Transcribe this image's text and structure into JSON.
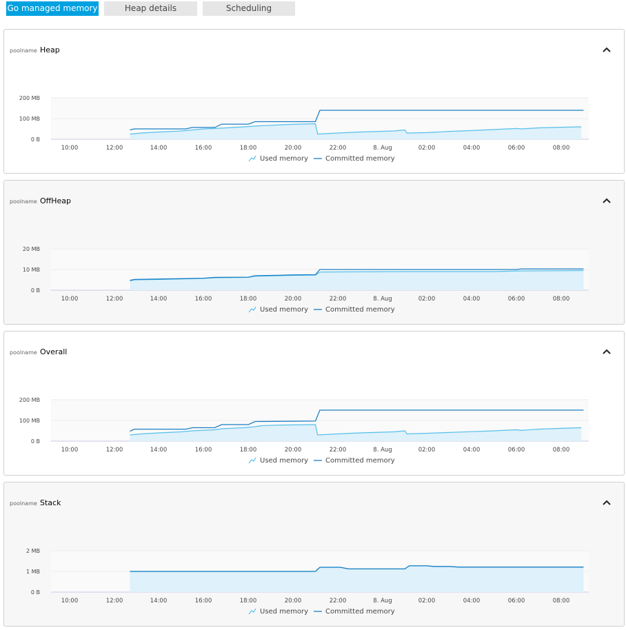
{
  "tabs": [
    {
      "label": "Go managed memory",
      "active": true
    },
    {
      "label": "Heap details",
      "active": false
    },
    {
      "label": "Scheduling",
      "active": false
    }
  ],
  "colors": {
    "accent": "#00a1e0",
    "committed_line": "#1a7fc4",
    "used_line": "#55bfea",
    "used_fill": "#dff1fa"
  },
  "legend": {
    "used": "Used memory",
    "committed": "Committed memory"
  },
  "panels": [
    {
      "pool_key": "poolname",
      "pool_name": "Heap",
      "chart_data": {
        "type": "area",
        "title": "",
        "xlabel": "",
        "ylabel": "",
        "x_ticks": [
          "10:00",
          "12:00",
          "14:00",
          "16:00",
          "18:00",
          "20:00",
          "22:00",
          "8. Aug",
          "02:00",
          "04:00",
          "06:00",
          "08:00"
        ],
        "y_ticks": [
          "0 B",
          "100 MB",
          "200 MB"
        ],
        "ylim_mb": [
          0,
          200
        ],
        "x_unit": "hours since 09:00 on 7 Aug",
        "series": [
          {
            "name": "Used memory",
            "type": "area",
            "points": [
              [
                3.7,
                25
              ],
              [
                4.2,
                30
              ],
              [
                5.0,
                35
              ],
              [
                6.0,
                40
              ],
              [
                6.5,
                45
              ],
              [
                7.0,
                50
              ],
              [
                7.5,
                52
              ],
              [
                8.0,
                55
              ],
              [
                8.8,
                60
              ],
              [
                9.1,
                62
              ],
              [
                9.5,
                65
              ],
              [
                10.5,
                70
              ],
              [
                11.0,
                72
              ],
              [
                12.0,
                75
              ],
              [
                12.1,
                25
              ],
              [
                13.0,
                30
              ],
              [
                14.0,
                35
              ],
              [
                15.5,
                40
              ],
              [
                16.0,
                45
              ],
              [
                16.1,
                30
              ],
              [
                17.0,
                32
              ],
              [
                18.0,
                38
              ],
              [
                19.0,
                42
              ],
              [
                20.0,
                47
              ],
              [
                21.0,
                52
              ],
              [
                21.2,
                50
              ],
              [
                22.0,
                55
              ],
              [
                23.0,
                58
              ],
              [
                23.9,
                60
              ]
            ]
          },
          {
            "name": "Committed memory",
            "type": "line",
            "points": [
              [
                3.7,
                45
              ],
              [
                3.9,
                50
              ],
              [
                6.2,
                50
              ],
              [
                6.5,
                57
              ],
              [
                7.5,
                57
              ],
              [
                7.8,
                73
              ],
              [
                9.0,
                73
              ],
              [
                9.3,
                85
              ],
              [
                12.0,
                85
              ],
              [
                12.2,
                140
              ],
              [
                24.0,
                140
              ]
            ]
          }
        ]
      }
    },
    {
      "pool_key": "poolname",
      "pool_name": "OffHeap",
      "chart_data": {
        "type": "area",
        "title": "",
        "xlabel": "",
        "ylabel": "",
        "x_ticks": [
          "10:00",
          "12:00",
          "14:00",
          "16:00",
          "18:00",
          "20:00",
          "22:00",
          "8. Aug",
          "02:00",
          "04:00",
          "06:00",
          "08:00"
        ],
        "y_ticks": [
          "0 B",
          "10 MB",
          "20 MB"
        ],
        "ylim_mb": [
          0,
          20
        ],
        "x_unit": "hours since 09:00 on 7 Aug",
        "series": [
          {
            "name": "Used memory",
            "type": "area",
            "points": [
              [
                3.7,
                4.5
              ],
              [
                3.9,
                5.0
              ],
              [
                5.0,
                5.2
              ],
              [
                6.2,
                5.5
              ],
              [
                7.0,
                5.7
              ],
              [
                7.5,
                6.0
              ],
              [
                9.0,
                6.2
              ],
              [
                9.3,
                6.8
              ],
              [
                10.3,
                7.0
              ],
              [
                11.0,
                7.2
              ],
              [
                12.0,
                7.3
              ],
              [
                12.2,
                8.8
              ],
              [
                16.0,
                9.0
              ],
              [
                20.0,
                9.0
              ],
              [
                21.0,
                9.3
              ],
              [
                24.0,
                9.5
              ]
            ]
          },
          {
            "name": "Committed memory",
            "type": "line",
            "points": [
              [
                3.7,
                4.8
              ],
              [
                3.9,
                5.2
              ],
              [
                5.0,
                5.4
              ],
              [
                6.2,
                5.6
              ],
              [
                7.0,
                5.8
              ],
              [
                7.5,
                6.2
              ],
              [
                9.0,
                6.3
              ],
              [
                9.3,
                7.0
              ],
              [
                10.3,
                7.2
              ],
              [
                11.0,
                7.4
              ],
              [
                12.0,
                7.5
              ],
              [
                12.2,
                10.0
              ],
              [
                21.0,
                10.0
              ],
              [
                21.2,
                10.3
              ],
              [
                24.0,
                10.3
              ]
            ]
          }
        ]
      }
    },
    {
      "pool_key": "poolname",
      "pool_name": "Overall",
      "chart_data": {
        "type": "area",
        "title": "",
        "xlabel": "",
        "ylabel": "",
        "x_ticks": [
          "10:00",
          "12:00",
          "14:00",
          "16:00",
          "18:00",
          "20:00",
          "22:00",
          "8. Aug",
          "02:00",
          "04:00",
          "06:00",
          "08:00"
        ],
        "y_ticks": [
          "0 B",
          "100 MB",
          "200 MB"
        ],
        "ylim_mb": [
          0,
          200
        ],
        "x_unit": "hours since 09:00 on 7 Aug",
        "series": [
          {
            "name": "Used memory",
            "type": "area",
            "points": [
              [
                3.7,
                30
              ],
              [
                4.2,
                35
              ],
              [
                5.0,
                40
              ],
              [
                6.0,
                45
              ],
              [
                6.5,
                50
              ],
              [
                7.5,
                55
              ],
              [
                7.8,
                60
              ],
              [
                8.8,
                65
              ],
              [
                9.3,
                70
              ],
              [
                9.6,
                75
              ],
              [
                10.5,
                78
              ],
              [
                12.0,
                80
              ],
              [
                12.1,
                30
              ],
              [
                13.0,
                35
              ],
              [
                14.0,
                40
              ],
              [
                15.5,
                45
              ],
              [
                16.0,
                50
              ],
              [
                16.1,
                35
              ],
              [
                17.0,
                38
              ],
              [
                18.0,
                42
              ],
              [
                19.0,
                46
              ],
              [
                20.0,
                50
              ],
              [
                21.0,
                55
              ],
              [
                21.2,
                52
              ],
              [
                22.0,
                58
              ],
              [
                23.0,
                62
              ],
              [
                23.9,
                65
              ]
            ]
          },
          {
            "name": "Committed memory",
            "type": "line",
            "points": [
              [
                3.7,
                48
              ],
              [
                3.9,
                58
              ],
              [
                6.2,
                58
              ],
              [
                6.5,
                65
              ],
              [
                7.5,
                65
              ],
              [
                7.8,
                80
              ],
              [
                9.0,
                80
              ],
              [
                9.3,
                95
              ],
              [
                12.0,
                97
              ],
              [
                12.2,
                150
              ],
              [
                24.0,
                150
              ]
            ]
          }
        ]
      }
    },
    {
      "pool_key": "poolname",
      "pool_name": "Stack",
      "chart_data": {
        "type": "area",
        "title": "",
        "xlabel": "",
        "ylabel": "",
        "x_ticks": [
          "10:00",
          "12:00",
          "14:00",
          "16:00",
          "18:00",
          "20:00",
          "22:00",
          "8. Aug",
          "02:00",
          "04:00",
          "06:00",
          "08:00"
        ],
        "y_ticks": [
          "0 B",
          "1 MB",
          "2 MB"
        ],
        "ylim_mb": [
          0,
          2
        ],
        "x_unit": "hours since 09:00 on 7 Aug",
        "series": [
          {
            "name": "Used memory",
            "type": "area",
            "points": [
              [
                3.7,
                1.0
              ],
              [
                12.0,
                1.0
              ],
              [
                12.2,
                1.2
              ],
              [
                13.1,
                1.2
              ],
              [
                13.5,
                1.12
              ],
              [
                16.0,
                1.12
              ],
              [
                16.2,
                1.27
              ],
              [
                17.0,
                1.27
              ],
              [
                17.3,
                1.24
              ],
              [
                18.0,
                1.24
              ],
              [
                18.4,
                1.21
              ],
              [
                24.0,
                1.21
              ]
            ]
          },
          {
            "name": "Committed memory",
            "type": "line",
            "points": [
              [
                3.7,
                1.0
              ],
              [
                12.0,
                1.0
              ],
              [
                12.2,
                1.2
              ],
              [
                13.1,
                1.2
              ],
              [
                13.5,
                1.12
              ],
              [
                16.0,
                1.12
              ],
              [
                16.2,
                1.27
              ],
              [
                17.0,
                1.27
              ],
              [
                17.3,
                1.24
              ],
              [
                18.0,
                1.24
              ],
              [
                18.4,
                1.21
              ],
              [
                24.0,
                1.21
              ]
            ]
          }
        ]
      }
    }
  ]
}
